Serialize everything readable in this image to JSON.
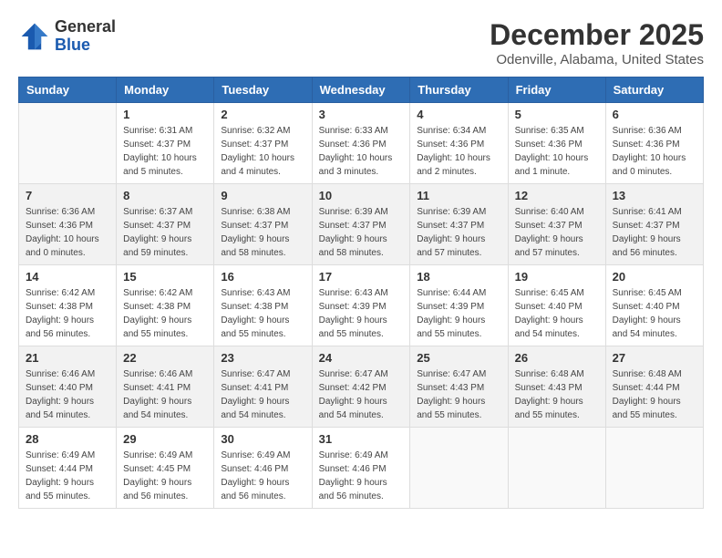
{
  "header": {
    "logo_line1": "General",
    "logo_line2": "Blue",
    "month": "December 2025",
    "location": "Odenville, Alabama, United States"
  },
  "weekdays": [
    "Sunday",
    "Monday",
    "Tuesday",
    "Wednesday",
    "Thursday",
    "Friday",
    "Saturday"
  ],
  "weeks": [
    [
      {
        "day": "",
        "info": ""
      },
      {
        "day": "1",
        "info": "Sunrise: 6:31 AM\nSunset: 4:37 PM\nDaylight: 10 hours\nand 5 minutes."
      },
      {
        "day": "2",
        "info": "Sunrise: 6:32 AM\nSunset: 4:37 PM\nDaylight: 10 hours\nand 4 minutes."
      },
      {
        "day": "3",
        "info": "Sunrise: 6:33 AM\nSunset: 4:36 PM\nDaylight: 10 hours\nand 3 minutes."
      },
      {
        "day": "4",
        "info": "Sunrise: 6:34 AM\nSunset: 4:36 PM\nDaylight: 10 hours\nand 2 minutes."
      },
      {
        "day": "5",
        "info": "Sunrise: 6:35 AM\nSunset: 4:36 PM\nDaylight: 10 hours\nand 1 minute."
      },
      {
        "day": "6",
        "info": "Sunrise: 6:36 AM\nSunset: 4:36 PM\nDaylight: 10 hours\nand 0 minutes."
      }
    ],
    [
      {
        "day": "7",
        "info": "Sunrise: 6:36 AM\nSunset: 4:36 PM\nDaylight: 10 hours\nand 0 minutes."
      },
      {
        "day": "8",
        "info": "Sunrise: 6:37 AM\nSunset: 4:37 PM\nDaylight: 9 hours\nand 59 minutes."
      },
      {
        "day": "9",
        "info": "Sunrise: 6:38 AM\nSunset: 4:37 PM\nDaylight: 9 hours\nand 58 minutes."
      },
      {
        "day": "10",
        "info": "Sunrise: 6:39 AM\nSunset: 4:37 PM\nDaylight: 9 hours\nand 58 minutes."
      },
      {
        "day": "11",
        "info": "Sunrise: 6:39 AM\nSunset: 4:37 PM\nDaylight: 9 hours\nand 57 minutes."
      },
      {
        "day": "12",
        "info": "Sunrise: 6:40 AM\nSunset: 4:37 PM\nDaylight: 9 hours\nand 57 minutes."
      },
      {
        "day": "13",
        "info": "Sunrise: 6:41 AM\nSunset: 4:37 PM\nDaylight: 9 hours\nand 56 minutes."
      }
    ],
    [
      {
        "day": "14",
        "info": "Sunrise: 6:42 AM\nSunset: 4:38 PM\nDaylight: 9 hours\nand 56 minutes."
      },
      {
        "day": "15",
        "info": "Sunrise: 6:42 AM\nSunset: 4:38 PM\nDaylight: 9 hours\nand 55 minutes."
      },
      {
        "day": "16",
        "info": "Sunrise: 6:43 AM\nSunset: 4:38 PM\nDaylight: 9 hours\nand 55 minutes."
      },
      {
        "day": "17",
        "info": "Sunrise: 6:43 AM\nSunset: 4:39 PM\nDaylight: 9 hours\nand 55 minutes."
      },
      {
        "day": "18",
        "info": "Sunrise: 6:44 AM\nSunset: 4:39 PM\nDaylight: 9 hours\nand 55 minutes."
      },
      {
        "day": "19",
        "info": "Sunrise: 6:45 AM\nSunset: 4:40 PM\nDaylight: 9 hours\nand 54 minutes."
      },
      {
        "day": "20",
        "info": "Sunrise: 6:45 AM\nSunset: 4:40 PM\nDaylight: 9 hours\nand 54 minutes."
      }
    ],
    [
      {
        "day": "21",
        "info": "Sunrise: 6:46 AM\nSunset: 4:40 PM\nDaylight: 9 hours\nand 54 minutes."
      },
      {
        "day": "22",
        "info": "Sunrise: 6:46 AM\nSunset: 4:41 PM\nDaylight: 9 hours\nand 54 minutes."
      },
      {
        "day": "23",
        "info": "Sunrise: 6:47 AM\nSunset: 4:41 PM\nDaylight: 9 hours\nand 54 minutes."
      },
      {
        "day": "24",
        "info": "Sunrise: 6:47 AM\nSunset: 4:42 PM\nDaylight: 9 hours\nand 54 minutes."
      },
      {
        "day": "25",
        "info": "Sunrise: 6:47 AM\nSunset: 4:43 PM\nDaylight: 9 hours\nand 55 minutes."
      },
      {
        "day": "26",
        "info": "Sunrise: 6:48 AM\nSunset: 4:43 PM\nDaylight: 9 hours\nand 55 minutes."
      },
      {
        "day": "27",
        "info": "Sunrise: 6:48 AM\nSunset: 4:44 PM\nDaylight: 9 hours\nand 55 minutes."
      }
    ],
    [
      {
        "day": "28",
        "info": "Sunrise: 6:49 AM\nSunset: 4:44 PM\nDaylight: 9 hours\nand 55 minutes."
      },
      {
        "day": "29",
        "info": "Sunrise: 6:49 AM\nSunset: 4:45 PM\nDaylight: 9 hours\nand 56 minutes."
      },
      {
        "day": "30",
        "info": "Sunrise: 6:49 AM\nSunset: 4:46 PM\nDaylight: 9 hours\nand 56 minutes."
      },
      {
        "day": "31",
        "info": "Sunrise: 6:49 AM\nSunset: 4:46 PM\nDaylight: 9 hours\nand 56 minutes."
      },
      {
        "day": "",
        "info": ""
      },
      {
        "day": "",
        "info": ""
      },
      {
        "day": "",
        "info": ""
      }
    ]
  ]
}
